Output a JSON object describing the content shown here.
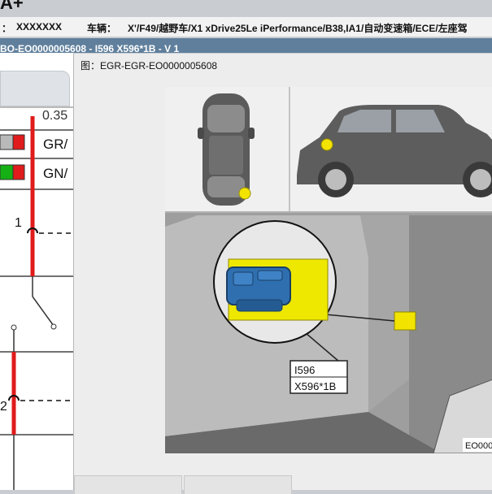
{
  "app": {
    "title": "A+"
  },
  "info_bar": {
    "vin_value": "XXXXXXX",
    "vehicle_label": "车辆：",
    "vehicle_value": "X'/F49/越野车/X1 xDrive25Le iPerformance/B38,IA1/自动变速箱/ECE/左座驾"
  },
  "path_bar": {
    "text": "BO-EO0000005608 - I596  X596*1B - V 1"
  },
  "left_panel": {
    "labels": [
      "GR/",
      "GN/",
      "1",
      "2"
    ],
    "connector_colors": {
      "grey": "#b9b9b9",
      "red": "#e01b1b",
      "green": "#14b014"
    }
  },
  "dialog": {
    "title": "图：EGR-EGR-EO0000005608",
    "callout_labels": [
      "I596",
      "X596*1B"
    ],
    "figure_code": "EO000",
    "marker_color": "#f2e400",
    "connector_color": "#2f6fb0"
  },
  "buttons": [
    {
      "label": ""
    },
    {
      "label": ""
    }
  ]
}
